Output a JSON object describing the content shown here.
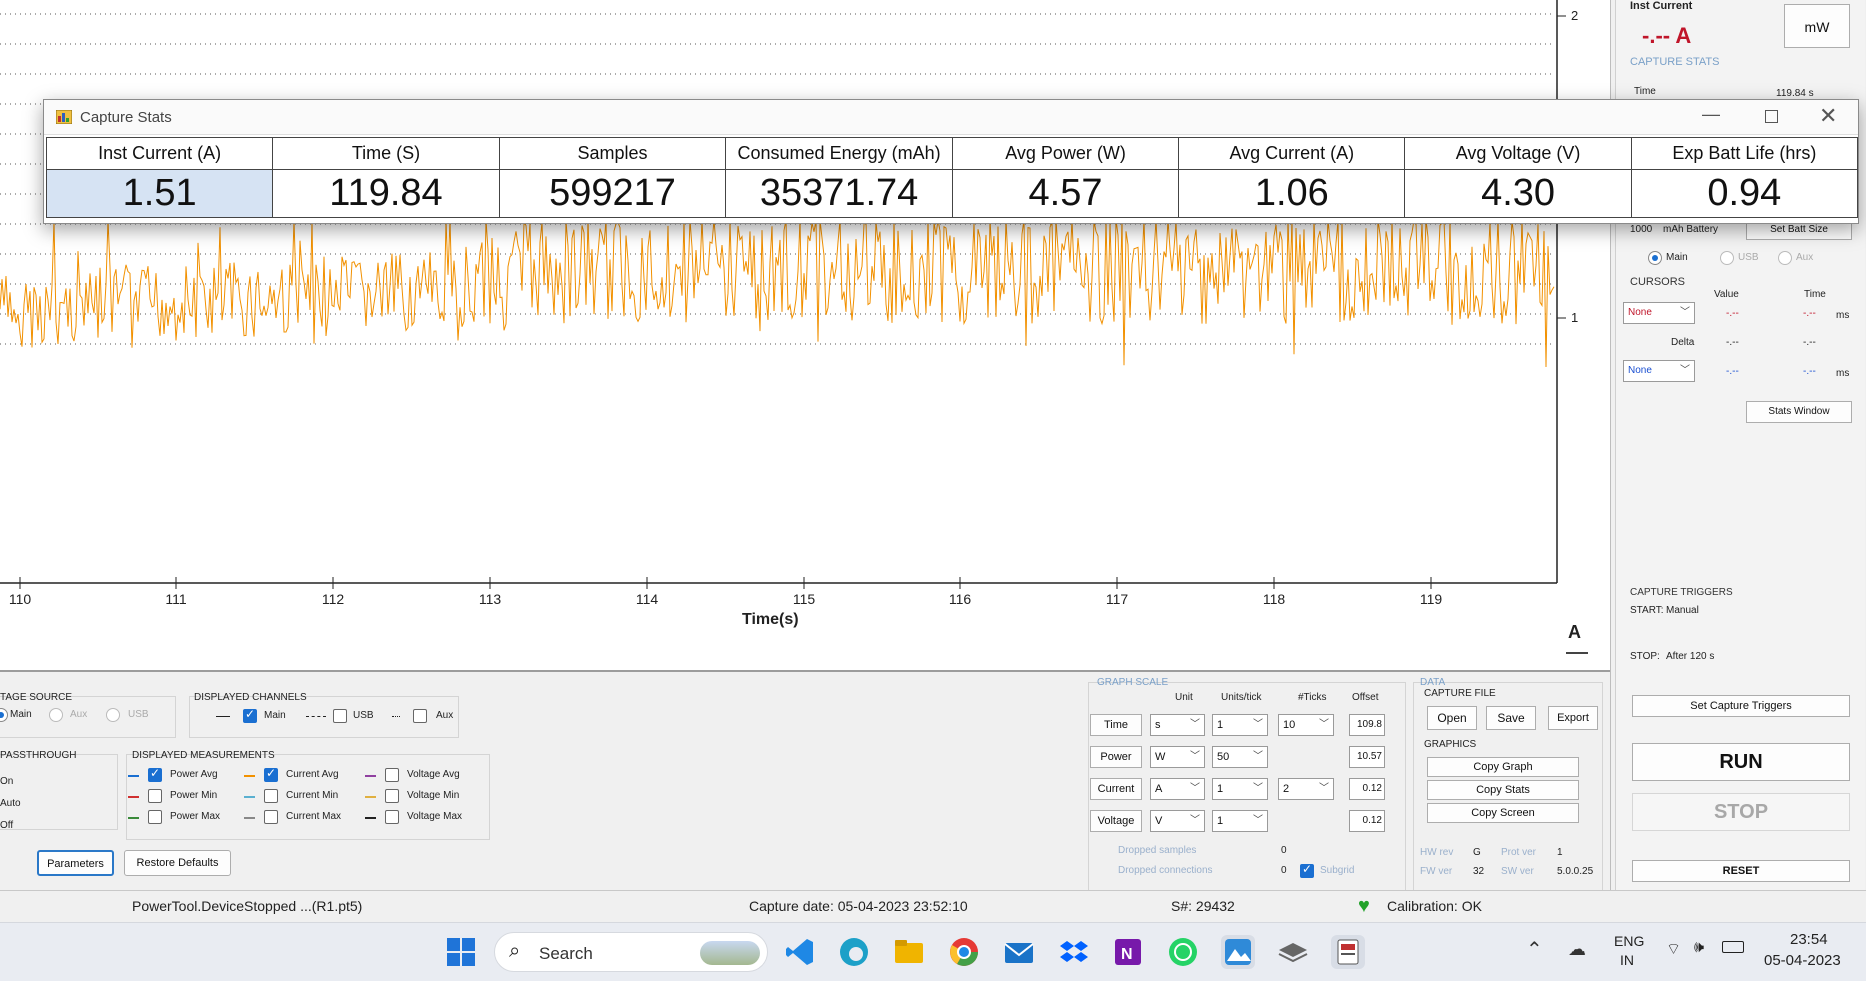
{
  "plot": {
    "x_ticks": [
      "110",
      "111",
      "112",
      "113",
      "114",
      "115",
      "116",
      "117",
      "118",
      "119"
    ],
    "y_ticks": [
      "2",
      "1"
    ],
    "x_label": "Time(s)",
    "unit_label": "A",
    "trace_color": "#F29100"
  },
  "stats_window": {
    "title": "Capture Stats",
    "columns": [
      {
        "header": "Inst Current (A)",
        "value": "1.51"
      },
      {
        "header": "Time (S)",
        "value": "119.84"
      },
      {
        "header": "Samples",
        "value": "599217"
      },
      {
        "header": "Consumed Energy (mAh)",
        "value": "35371.74"
      },
      {
        "header": "Avg Power (W)",
        "value": "4.57"
      },
      {
        "header": "Avg Current (A)",
        "value": "1.06"
      },
      {
        "header": "Avg Voltage (V)",
        "value": "4.30"
      },
      {
        "header": "Exp Batt Life (hrs)",
        "value": "0.94"
      }
    ]
  },
  "right_panel": {
    "inst_current_label": "Inst Current",
    "inst_current_value": "-.-- A",
    "unit_button": "mW",
    "capture_stats_label": "CAPTURE STATS",
    "time_label": "Time",
    "time_value": "119.84 s",
    "battery_size": "1000",
    "battery_unit": "mAh Battery",
    "set_batt_size": "Set Batt Size",
    "batt_radios": [
      "Main",
      "USB",
      "Aux"
    ],
    "cursors_label": "CURSORS",
    "value_header": "Value",
    "time_header": "Time",
    "cursor1_select": "None",
    "cursor1_value": "-.--",
    "cursor1_time": "-.--",
    "cursor_unit": "ms",
    "delta_label": "Delta",
    "delta_value": "-.--",
    "delta_time": "-.--",
    "cursor2_select": "None",
    "cursor2_value": "-.--",
    "cursor2_time": "-.--",
    "stats_window_button": "Stats Window",
    "capture_triggers_label": "CAPTURE TRIGGERS",
    "start_label": "START:",
    "start_value": "Manual",
    "stop_label": "STOP:",
    "stop_value": "After 120 s",
    "set_triggers_button": "Set Capture Triggers",
    "run_button": "RUN",
    "stop_button": "STOP",
    "reset_button": "RESET"
  },
  "bottom": {
    "voltage_source_label": "TAGE SOURCE",
    "voltage_source_radios": [
      "Main",
      "Aux",
      "USB"
    ],
    "displayed_channels_label": "DISPLAYED CHANNELS",
    "channels": [
      {
        "label": "Main",
        "checked": true
      },
      {
        "label": "USB",
        "checked": false
      },
      {
        "label": "Aux",
        "checked": false
      }
    ],
    "passthrough_label": "PASSTHROUGH",
    "passthrough_options": [
      "On",
      "Auto",
      "Off"
    ],
    "displayed_measurements_label": "DISPLAYED MEASUREMENTS",
    "measurements": [
      {
        "label": "Power Avg",
        "checked": true,
        "color": "#1a6fd1"
      },
      {
        "label": "Power Min",
        "checked": false,
        "color": "#d03030"
      },
      {
        "label": "Power Max",
        "checked": false,
        "color": "#3a8a3a"
      },
      {
        "label": "Current Avg",
        "checked": true,
        "color": "#F29100"
      },
      {
        "label": "Current Min",
        "checked": false,
        "color": "#5ab0d0"
      },
      {
        "label": "Current Max",
        "checked": false,
        "color": "#888888"
      },
      {
        "label": "Voltage Avg",
        "checked": false,
        "color": "#9040a0"
      },
      {
        "label": "Voltage Min",
        "checked": false,
        "color": "#e0b040"
      },
      {
        "label": "Voltage Max",
        "checked": false,
        "color": "#222222"
      }
    ],
    "parameters_button": "Parameters",
    "restore_defaults_button": "Restore Defaults",
    "graph_scale_label": "GRAPH SCALE",
    "scale_headers": [
      "Unit",
      "Units/tick",
      "#Ticks",
      "Offset"
    ],
    "scale_rows": [
      {
        "name": "Time",
        "unit": "s",
        "units_tick": "1",
        "ticks": "10",
        "offset": "109.8"
      },
      {
        "name": "Power",
        "unit": "W",
        "units_tick": "50",
        "ticks": "",
        "offset": "10.57"
      },
      {
        "name": "Current",
        "unit": "A",
        "units_tick": "1",
        "ticks": "2",
        "offset": "0.12"
      },
      {
        "name": "Voltage",
        "unit": "V",
        "units_tick": "1",
        "ticks": "",
        "offset": "0.12"
      }
    ],
    "dropped_samples_label": "Dropped samples",
    "dropped_samples_value": "0",
    "dropped_connections_label": "Dropped connections",
    "dropped_connections_value": "0",
    "subgrid_label": "Subgrid",
    "data_label": "DATA",
    "capture_file_label": "CAPTURE FILE",
    "open_button": "Open",
    "save_button": "Save",
    "export_button": "Export",
    "graphics_label": "GRAPHICS",
    "copy_graph": "Copy Graph",
    "copy_stats": "Copy Stats",
    "copy_screen": "Copy Screen",
    "hw_rev_label": "HW rev",
    "hw_rev_value": "G",
    "prot_ver_label": "Prot ver",
    "prot_ver_value": "1",
    "fw_ver_label": "FW ver",
    "fw_ver_value": "32",
    "sw_ver_label": "SW ver",
    "sw_ver_value": "5.0.0.25"
  },
  "status_bar": {
    "device": "PowerTool.DeviceStopped ...(R1.pt5)",
    "capture_date": "Capture date: 05-04-2023 23:52:10",
    "serial": "S#: 29432",
    "calibration": "Calibration: OK"
  },
  "taskbar": {
    "search_label": "Search",
    "lang_top": "ENG",
    "lang_bottom": "IN",
    "time": "23:54",
    "date": "05-04-2023"
  }
}
